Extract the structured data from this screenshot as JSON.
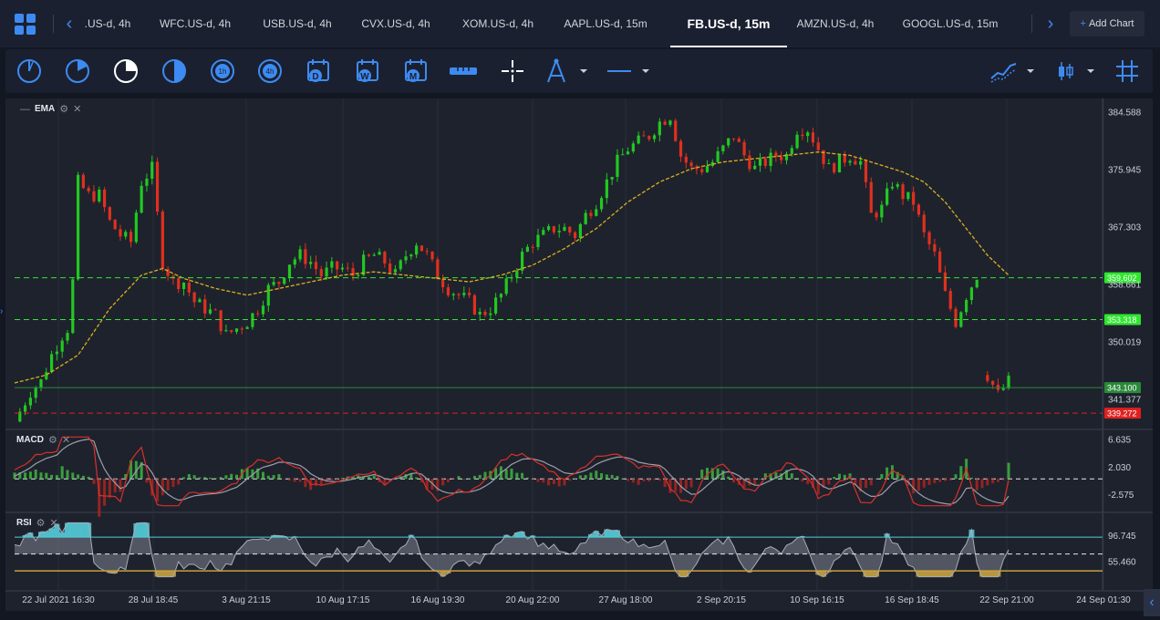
{
  "tabs": {
    "items": [
      {
        "label": ".US-d, 4h",
        "active": false
      },
      {
        "label": "WFC.US-d, 4h",
        "active": false
      },
      {
        "label": "USB.US-d, 4h",
        "active": false
      },
      {
        "label": "CVX.US-d, 4h",
        "active": false
      },
      {
        "label": "XOM.US-d, 4h",
        "active": false
      },
      {
        "label": "AAPL.US-d, 15m",
        "active": false
      },
      {
        "label": "FB.US-d, 15m",
        "active": true
      },
      {
        "label": "AMZN.US-d, 4h",
        "active": false
      },
      {
        "label": "GOOGL.US-d, 15m",
        "active": false
      }
    ],
    "add_chart_label": "Add Chart"
  },
  "toolbar": {
    "tools": [
      "clock-15m-icon",
      "clock-30m-icon",
      "clock-1h-icon",
      "clock-2h-icon",
      "period-1h-icon",
      "period-4h-icon",
      "calendar-day-icon",
      "calendar-week-icon",
      "calendar-month-icon",
      "ruler-icon",
      "crosshair-icon",
      "compass-icon",
      "line-icon",
      "line-chart-type-icon",
      "candlestick-icon",
      "grid-icon"
    ],
    "calendar_letters": {
      "day": "D",
      "week": "W",
      "month": "M"
    },
    "period_labels": {
      "hour": "1h",
      "four_hour": "4h"
    }
  },
  "main_chart": {
    "indicator": "EMA",
    "price_ticks": [
      "384.588",
      "375.945",
      "367.303",
      "350.019",
      "341.377"
    ],
    "levels": [
      {
        "label": "359.602",
        "color": "#2ee62e",
        "style": "dashed"
      },
      {
        "label": "353.318",
        "color": "#2ee62e",
        "style": "dashed"
      },
      {
        "label": "343.100",
        "color": "#2a8a3a",
        "style": "solid"
      },
      {
        "label": "339.272",
        "color": "#e02020",
        "style": "dashed"
      }
    ],
    "partial_label": "358.661"
  },
  "macd": {
    "label": "MACD",
    "ticks": [
      "6.635",
      "2.030",
      "-2.575"
    ]
  },
  "rsi": {
    "label": "RSI",
    "ticks": [
      "96.745",
      "55.460"
    ]
  },
  "time_axis": [
    "22 Jul 2021 16:30",
    "28 Jul 18:45",
    "3 Aug 21:15",
    "10 Aug 17:15",
    "16 Aug 19:30",
    "20 Aug 22:00",
    "27 Aug 18:00",
    "2 Sep 20:15",
    "10 Sep 16:15",
    "16 Sep 18:45",
    "22 Sep 21:00",
    "24 Sep 01:30"
  ],
  "colors": {
    "up": "#21c821",
    "down": "#e0301e",
    "ema": "#d9b020",
    "accent": "#3d8bf2",
    "rsi_high": "#4fd0dc",
    "rsi_low": "#c9a13a"
  },
  "chart_data": {
    "type": "candlestick",
    "title": "FB.US-d, 15m",
    "x_labels": [
      "22 Jul 2021 16:30",
      "28 Jul 18:45",
      "3 Aug 21:15",
      "10 Aug 17:15",
      "16 Aug 19:30",
      "20 Aug 22:00",
      "27 Aug 18:00",
      "2 Sep 20:15",
      "10 Sep 16:15",
      "16 Sep 18:45",
      "22 Sep 21:00",
      "24 Sep 01:30"
    ],
    "ylim": [
      337.5,
      386
    ],
    "close_path": [
      [
        0,
        338
      ],
      [
        3,
        342.5
      ],
      [
        5,
        344
      ],
      [
        7,
        348
      ],
      [
        9,
        351
      ],
      [
        10,
        352
      ],
      [
        11,
        359
      ],
      [
        12,
        374
      ],
      [
        14,
        372
      ],
      [
        16,
        372
      ],
      [
        18,
        368
      ],
      [
        20,
        366
      ],
      [
        22,
        365
      ],
      [
        24,
        374
      ],
      [
        26,
        376
      ],
      [
        28,
        362
      ],
      [
        30,
        359
      ],
      [
        32,
        359
      ],
      [
        34,
        356
      ],
      [
        36,
        355
      ],
      [
        38,
        354
      ],
      [
        40,
        351
      ],
      [
        42,
        352
      ],
      [
        44,
        353
      ],
      [
        46,
        355
      ],
      [
        48,
        358
      ],
      [
        50,
        359
      ],
      [
        52,
        362
      ],
      [
        54,
        363
      ],
      [
        56,
        362
      ],
      [
        58,
        360
      ],
      [
        60,
        361
      ],
      [
        62,
        361
      ],
      [
        64,
        360
      ],
      [
        66,
        362
      ],
      [
        68,
        363
      ],
      [
        70,
        362
      ],
      [
        72,
        360
      ],
      [
        74,
        363
      ],
      [
        76,
        365
      ],
      [
        78,
        363
      ],
      [
        80,
        360
      ],
      [
        82,
        358
      ],
      [
        84,
        357
      ],
      [
        86,
        356
      ],
      [
        88,
        354
      ],
      [
        90,
        355
      ],
      [
        92,
        357
      ],
      [
        94,
        360
      ],
      [
        96,
        363
      ],
      [
        98,
        365
      ],
      [
        100,
        366
      ],
      [
        102,
        367
      ],
      [
        104,
        367
      ],
      [
        106,
        366
      ],
      [
        108,
        369
      ],
      [
        110,
        371
      ],
      [
        112,
        374
      ],
      [
        114,
        377
      ],
      [
        116,
        379
      ],
      [
        118,
        380
      ],
      [
        120,
        381
      ],
      [
        122,
        383
      ],
      [
        124,
        384
      ],
      [
        126,
        378
      ],
      [
        128,
        376
      ],
      [
        130,
        376
      ],
      [
        132,
        377
      ],
      [
        134,
        379
      ],
      [
        136,
        381
      ],
      [
        138,
        378
      ],
      [
        140,
        376
      ],
      [
        142,
        377
      ],
      [
        144,
        378
      ],
      [
        146,
        378
      ],
      [
        148,
        382
      ],
      [
        150,
        382
      ],
      [
        152,
        379
      ],
      [
        154,
        376
      ],
      [
        156,
        377
      ],
      [
        158,
        378
      ],
      [
        160,
        377
      ],
      [
        162,
        369
      ],
      [
        164,
        370
      ],
      [
        166,
        374
      ],
      [
        168,
        372
      ],
      [
        170,
        371
      ],
      [
        172,
        366
      ],
      [
        174,
        363
      ],
      [
        176,
        357
      ],
      [
        178,
        353
      ],
      [
        180,
        357
      ],
      [
        182,
        360
      ],
      [
        184,
        345
      ],
      [
        186,
        342
      ],
      [
        188,
        344
      ]
    ],
    "ema_path": [
      [
        0,
        343.8
      ],
      [
        6,
        345
      ],
      [
        12,
        348
      ],
      [
        18,
        355
      ],
      [
        24,
        360
      ],
      [
        28,
        361
      ],
      [
        32,
        359.5
      ],
      [
        38,
        358
      ],
      [
        44,
        357
      ],
      [
        50,
        358
      ],
      [
        56,
        359
      ],
      [
        62,
        360
      ],
      [
        68,
        360.5
      ],
      [
        74,
        360
      ],
      [
        80,
        359.5
      ],
      [
        86,
        359
      ],
      [
        92,
        360
      ],
      [
        98,
        361.5
      ],
      [
        104,
        364
      ],
      [
        110,
        367
      ],
      [
        116,
        371
      ],
      [
        122,
        374
      ],
      [
        128,
        376
      ],
      [
        134,
        377
      ],
      [
        140,
        377.5
      ],
      [
        146,
        378
      ],
      [
        152,
        378.5
      ],
      [
        158,
        378
      ],
      [
        162,
        377
      ],
      [
        168,
        375.5
      ],
      [
        172,
        374
      ],
      [
        176,
        371
      ],
      [
        180,
        367
      ],
      [
        184,
        363
      ],
      [
        188,
        360
      ]
    ],
    "macd_range": [
      -5,
      7.5
    ],
    "rsi_range": [
      20,
      100
    ],
    "rsi_bands": [
      75,
      35
    ]
  }
}
